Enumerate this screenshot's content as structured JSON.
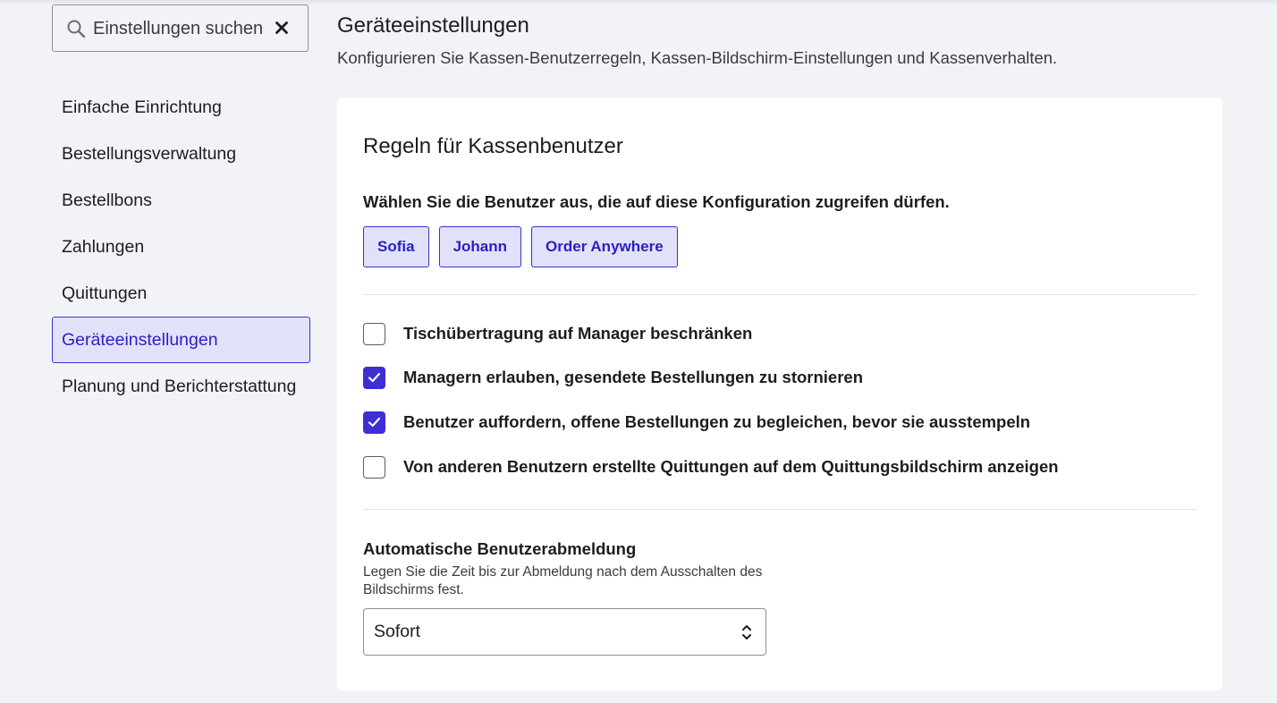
{
  "search": {
    "value": "",
    "placeholder": "Einstellungen suchen"
  },
  "sidebar": {
    "items": [
      {
        "label": "Einfache Einrichtung"
      },
      {
        "label": "Bestellungsverwaltung"
      },
      {
        "label": "Bestellbons"
      },
      {
        "label": "Zahlungen"
      },
      {
        "label": "Quittungen"
      },
      {
        "label": "Geräteeinstellungen",
        "active": true
      },
      {
        "label": "Planung und Berichterstattung"
      }
    ]
  },
  "header": {
    "title": "Geräteeinstellungen",
    "subtitle": "Konfigurieren Sie Kassen-Benutzerregeln, Kassen-Bildschirm-Einstellungen und Kassenverhalten."
  },
  "card": {
    "title": "Regeln für Kassenbenutzer",
    "users_label": "Wählen Sie die Benutzer aus, die auf diese Konfiguration zugreifen dürfen.",
    "users": [
      "Sofia",
      "Johann",
      "Order Anywhere"
    ],
    "options": [
      {
        "label": "Tischübertragung auf Manager beschränken",
        "checked": false
      },
      {
        "label": "Managern erlauben, gesendete Bestellungen zu stornieren",
        "checked": true
      },
      {
        "label": "Benutzer auffordern, offene Bestellungen zu begleichen, bevor sie ausstempeln",
        "checked": true
      },
      {
        "label": "Von anderen Benutzern erstellte Quittungen auf dem Quittungsbildschirm anzeigen",
        "checked": false
      }
    ],
    "logout": {
      "title": "Automatische Benutzerabmeldung",
      "description": "Legen Sie die Zeit bis zur Abmeldung nach dem Ausschalten des Bildschirms fest.",
      "selected": "Sofort"
    }
  },
  "colors": {
    "accent": "#3d2fd4",
    "accent_bg": "#e1e2fa",
    "page_bg": "#f2f3f7",
    "card_bg": "#ffffff"
  },
  "icons": {
    "search": "search-icon",
    "clear": "close-icon",
    "check": "check-icon",
    "select": "chevron-up-down-icon"
  }
}
